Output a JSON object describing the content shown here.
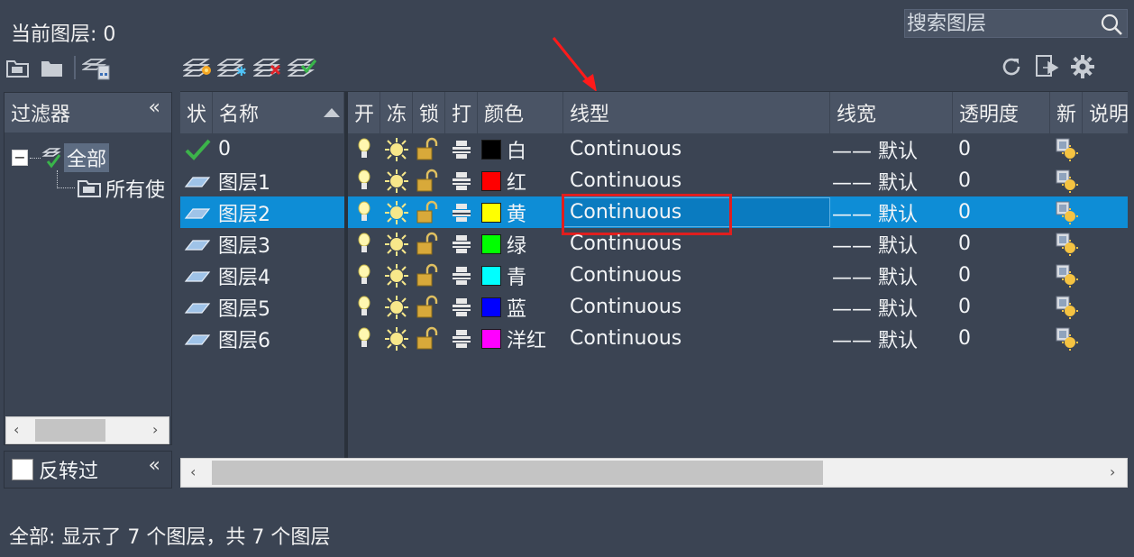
{
  "header": {
    "current_layer_label": "当前图层: 0",
    "search_placeholder": "搜索图层"
  },
  "toolbar_left": [
    "new-property-filter-icon",
    "new-group-filter-icon",
    "layer-states-manager-icon"
  ],
  "toolbar_mid": [
    "new-layer-icon",
    "new-layer-vp-frozen-icon",
    "delete-layer-icon",
    "set-current-icon"
  ],
  "toolbar_right": [
    "refresh-icon",
    "settings-dialog-icon",
    "gear-icon"
  ],
  "filter_panel": {
    "title": "过滤器",
    "collapse_glyph": "«",
    "tree": [
      {
        "label": "全部",
        "expander": "−"
      },
      {
        "label": "所有使"
      }
    ],
    "invert_label": "反转过",
    "invert_checked": false
  },
  "columns": {
    "status": "状",
    "name": "名称",
    "on": "开",
    "freeze": "冻",
    "lock": "锁",
    "plot": "打",
    "color": "颜色",
    "linetype": "线型",
    "lineweight": "线宽",
    "transparency": "透明度",
    "new_vp": "新",
    "description": "说明"
  },
  "layers": [
    {
      "name": "0",
      "color_name": "白",
      "color_hex": "#000000",
      "linetype": "Continuous",
      "lineweight": "—— 默认",
      "transparency": "0",
      "current": true,
      "selected": false
    },
    {
      "name": "图层1",
      "color_name": "红",
      "color_hex": "#ff0000",
      "linetype": "Continuous",
      "lineweight": "—— 默认",
      "transparency": "0",
      "current": false,
      "selected": false
    },
    {
      "name": "图层2",
      "color_name": "黄",
      "color_hex": "#ffff00",
      "linetype": "Continuous",
      "lineweight": "—— 默认",
      "transparency": "0",
      "current": false,
      "selected": true
    },
    {
      "name": "图层3",
      "color_name": "绿",
      "color_hex": "#00ff00",
      "linetype": "Continuous",
      "lineweight": "—— 默认",
      "transparency": "0",
      "current": false,
      "selected": false
    },
    {
      "name": "图层4",
      "color_name": "青",
      "color_hex": "#00ffff",
      "linetype": "Continuous",
      "lineweight": "—— 默认",
      "transparency": "0",
      "current": false,
      "selected": false
    },
    {
      "name": "图层5",
      "color_name": "蓝",
      "color_hex": "#0000ff",
      "linetype": "Continuous",
      "lineweight": "—— 默认",
      "transparency": "0",
      "current": false,
      "selected": false
    },
    {
      "name": "图层6",
      "color_name": "洋红",
      "color_hex": "#ff00ff",
      "linetype": "Continuous",
      "lineweight": "—— 默认",
      "transparency": "0",
      "current": false,
      "selected": false
    }
  ],
  "status_bar": "全部: 显示了 7 个图层，共 7 个图层",
  "colors": {
    "background": "#3b4453",
    "header": "#4a5465",
    "selection": "#0e8dd6",
    "highlight_box": "#e01e1e",
    "arrow": "#ff1a1a"
  }
}
